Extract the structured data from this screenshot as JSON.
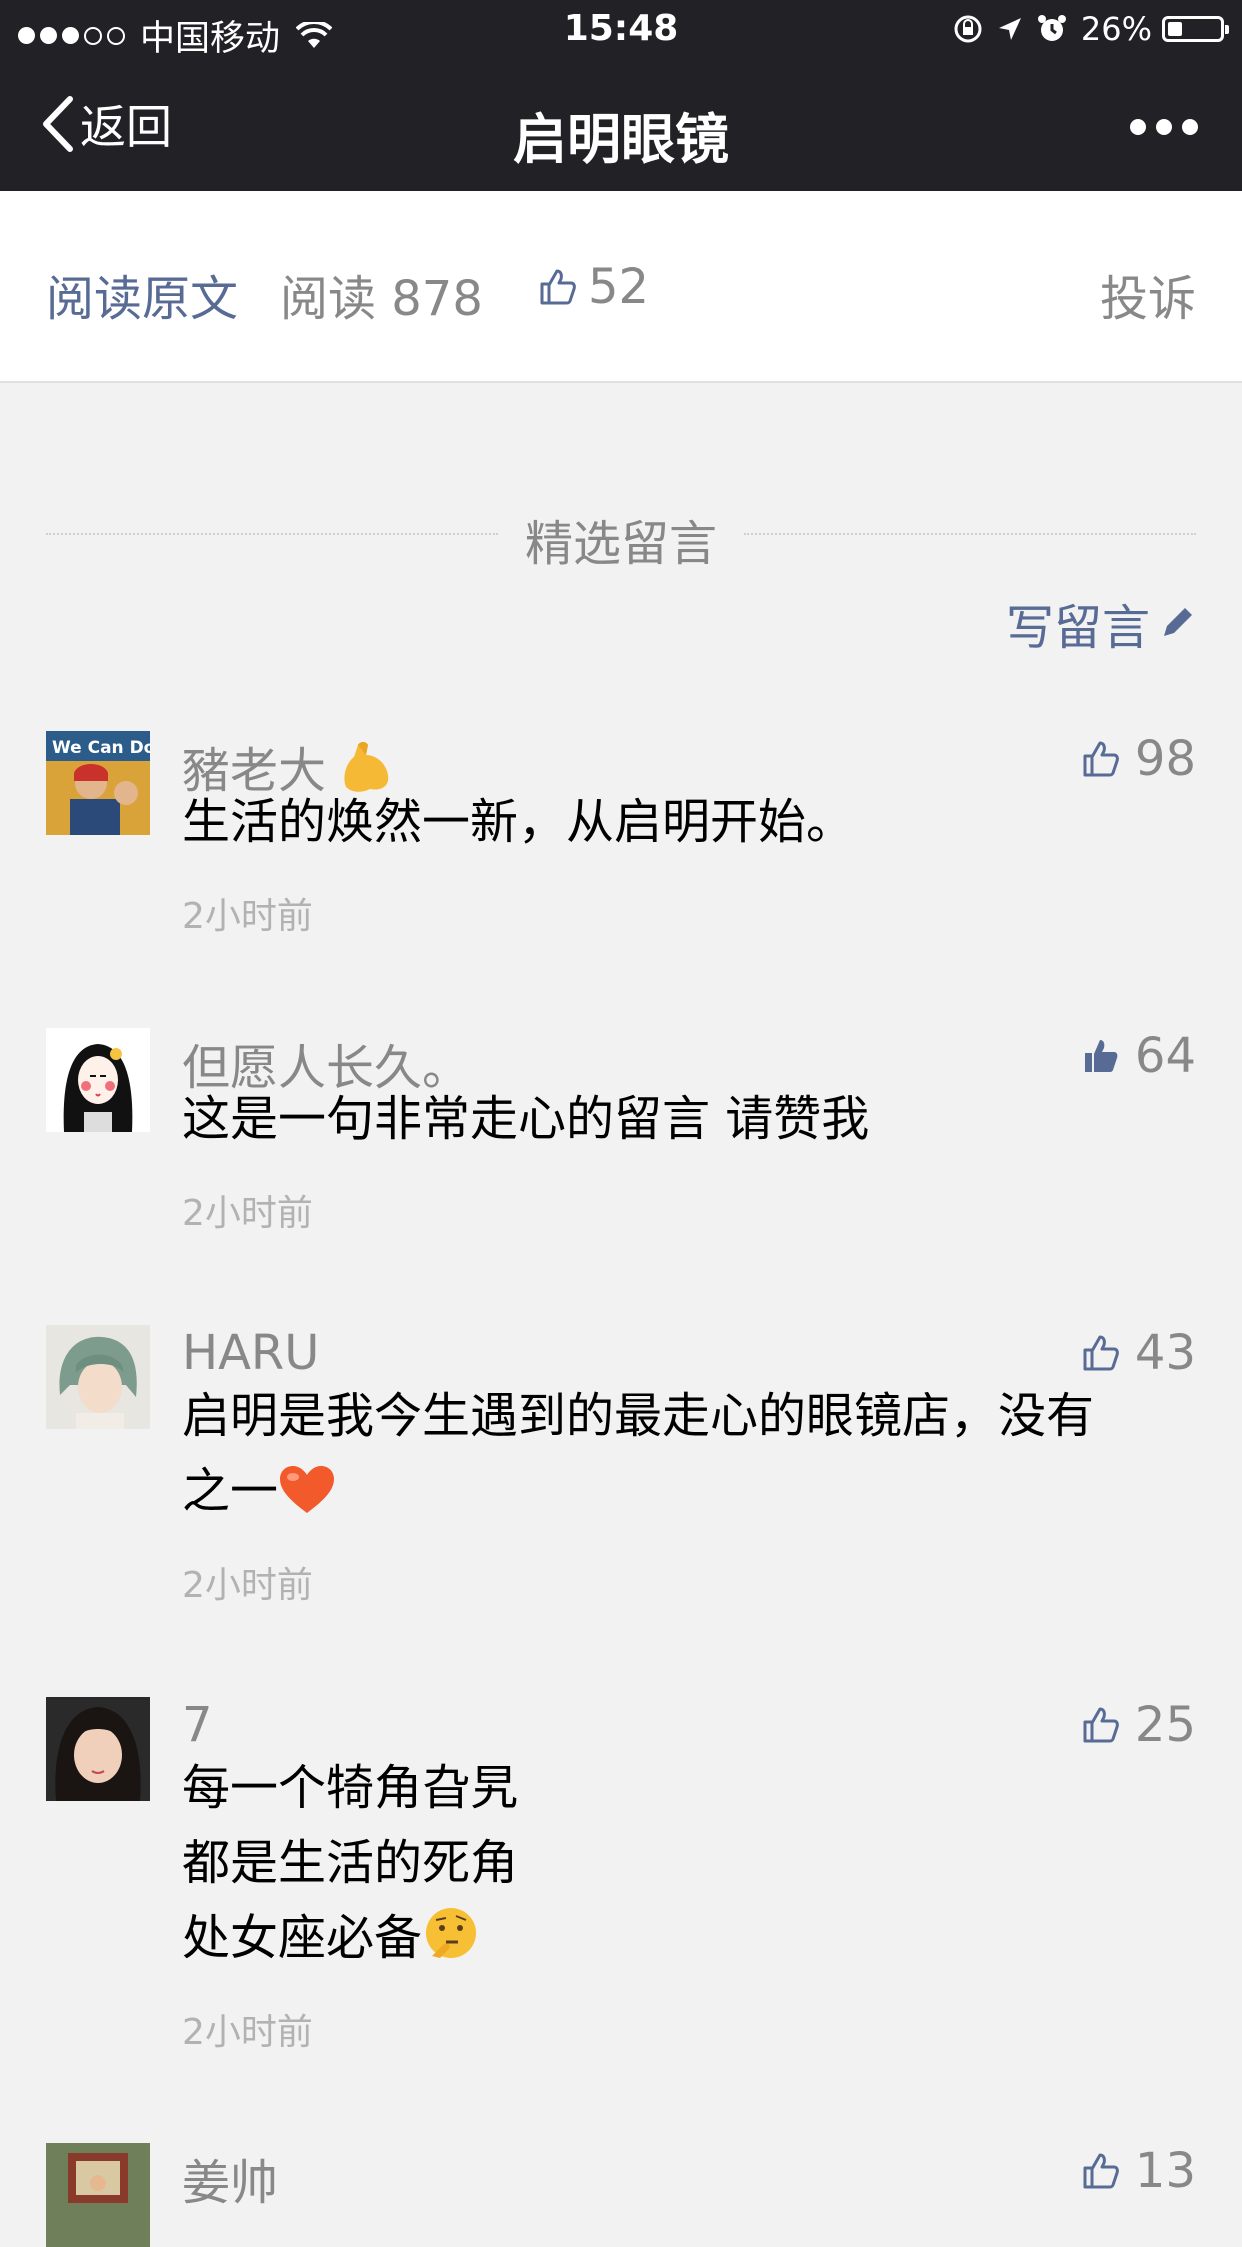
{
  "status_bar": {
    "carrier": "中国移动",
    "time": "15:48",
    "battery": "26%",
    "battery_level": 0.26
  },
  "nav": {
    "back_label": "返回",
    "title": "启明眼镜"
  },
  "article": {
    "read_original": "阅读原文",
    "read_count": "阅读 878",
    "likes": "52",
    "report": "投诉"
  },
  "comments_section": {
    "header": "精选留言",
    "write_label": "写留言"
  },
  "comments": [
    {
      "name": "豬老大",
      "text": "生活的焕然一新，从启明开始。",
      "time": "2小时前",
      "likes": "98",
      "liked": false
    },
    {
      "name": "但愿人长久。",
      "text": "这是一句非常走心的留言 请赞我",
      "time": "2小时前",
      "likes": "64",
      "liked": true
    },
    {
      "name": "HARU",
      "text_line1": "启明是我今生遇到的最走心的眼镜店，没有",
      "text_line2": "之一",
      "time": "2小时前",
      "likes": "43",
      "liked": false
    },
    {
      "name": "7",
      "text_line1": "每一个犄角旮旯",
      "text_line2": "都是生活的死角",
      "text_line3": "处女座必备",
      "time": "2小时前",
      "likes": "25",
      "liked": false
    },
    {
      "name": "姜帅",
      "likes": "13",
      "liked": false
    }
  ],
  "colors": {
    "bar_bg": "#222226",
    "link_blue": "#576b95",
    "page_bg": "#f2f2f2"
  }
}
